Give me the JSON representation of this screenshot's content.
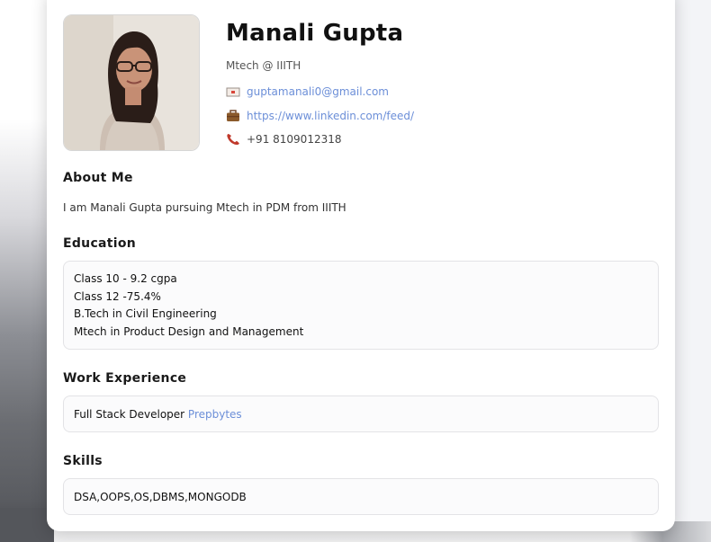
{
  "profile": {
    "name": "Manali Gupta",
    "subtitle": "Mtech @ IIITH",
    "email": "guptamanali0@gmail.com",
    "linkedin": "https://www.linkedin.com/feed/",
    "phone": "+91 8109012318"
  },
  "about": {
    "title": "About Me",
    "text": "I am Manali Gupta pursuing Mtech in PDM from IIITH"
  },
  "education": {
    "title": "Education",
    "items": [
      "Class 10 - 9.2 cgpa",
      "Class 12 -75.4%",
      "B.Tech in Civil Engineering",
      "Mtech in Product Design and Management"
    ]
  },
  "work": {
    "title": "Work Experience",
    "role": "Full Stack Developer",
    "company": "Prepbytes"
  },
  "skills": {
    "title": "Skills",
    "text": "DSA,OOPS,OS,DBMS,MONGODB"
  },
  "icons": {
    "email": "envelope-icon",
    "linkedin": "briefcase-icon",
    "phone": "phone-icon"
  },
  "colors": {
    "link": "#6c8fd8",
    "card_bg": "#ffffff",
    "box_border": "#e3e3e6"
  }
}
